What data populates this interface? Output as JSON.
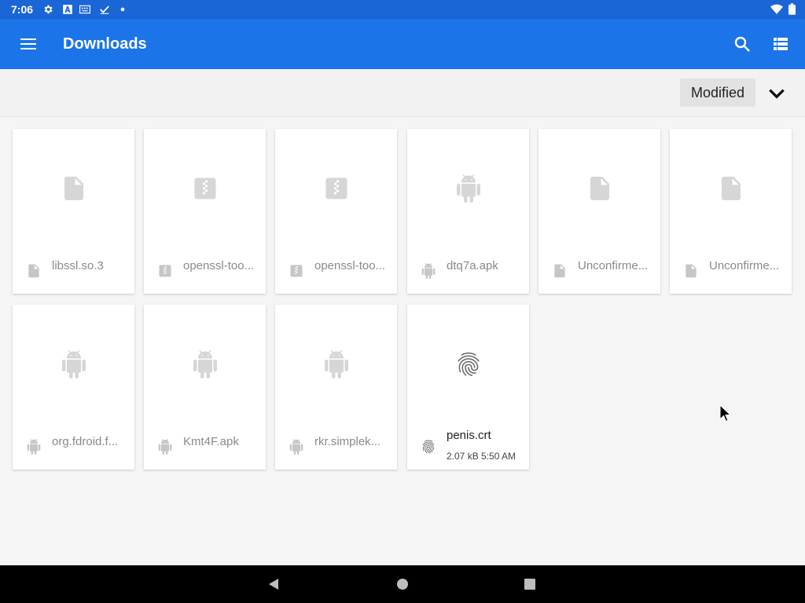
{
  "status_bar": {
    "time": "7:06",
    "icons": [
      "gear-icon",
      "font-a-icon",
      "keyboard-icon",
      "check-icon",
      "dot-icon"
    ],
    "right_icons": [
      "wifi-icon",
      "battery-icon"
    ]
  },
  "app_bar": {
    "title": "Downloads",
    "menu_icon": "hamburger-icon",
    "search_icon": "search-icon",
    "view_icon": "list-view-icon",
    "color": "#1b74e8"
  },
  "sort": {
    "label": "Modified",
    "toggle_icon": "chevron-down-icon"
  },
  "files": [
    {
      "name": "libssl.so.3",
      "type": "file"
    },
    {
      "name": "openssl-too...",
      "type": "archive"
    },
    {
      "name": "openssl-too...",
      "type": "archive"
    },
    {
      "name": "dtq7a.apk",
      "type": "android"
    },
    {
      "name": "Unconfirme...",
      "type": "file"
    },
    {
      "name": "Unconfirme...",
      "type": "file"
    },
    {
      "name": "org.fdroid.f...",
      "type": "android"
    },
    {
      "name": "Kmt4F.apk",
      "type": "android"
    },
    {
      "name": "rkr.simplek...",
      "type": "android"
    },
    {
      "name": "penis.crt",
      "type": "certificate",
      "meta": "2.07 kB 5:50 AM"
    }
  ],
  "nav_bar": {
    "back": "back-triangle-icon",
    "home": "home-circle-icon",
    "recent": "recent-square-icon"
  }
}
